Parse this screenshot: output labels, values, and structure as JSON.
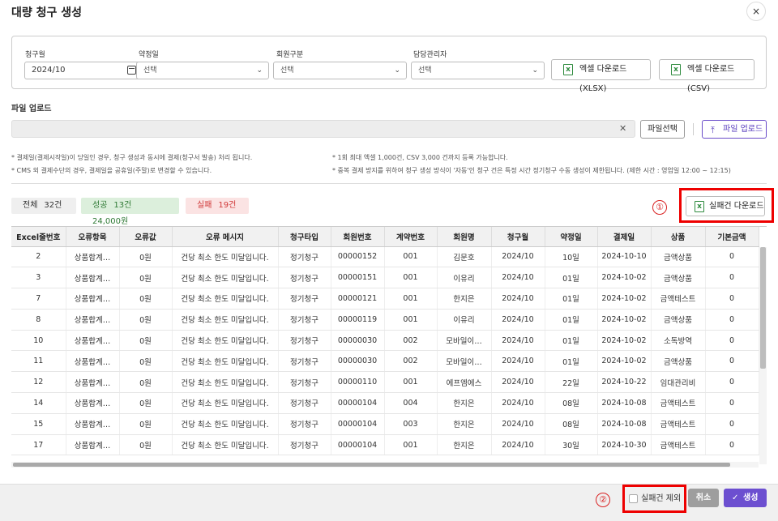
{
  "dialog": {
    "title": "대량 청구 생성",
    "close_icon": "×"
  },
  "filters": {
    "billing_month_label": "청구월",
    "billing_month_value": "2024/10",
    "contract_day_label": "약정일",
    "contract_day_value": "선택",
    "member_type_label": "회원구분",
    "member_type_value": "선택",
    "manager_label": "담당관리자",
    "manager_value": "선택",
    "excel_xlsx_label": "엑셀 다운로드(XLSX)",
    "excel_csv_label": "엑셀 다운로드(CSV)"
  },
  "upload": {
    "label": "파일 업로드",
    "select_label": "파일선택",
    "upload_label": "파일 업로드"
  },
  "notes": {
    "left_1": "* 결제일(결제시작일)이 당일인 경우, 청구 생성과 동시에 결제(청구서 발송) 처리 됩니다.",
    "left_2": "* CMS 외 결제수단의 경우, 결제일을 공휴일(주말)로 변경할 수 있습니다.",
    "right_1": "* 1회 최대 엑셀 1,000건, CSV 3,000 건까지 등록 가능합니다.",
    "right_2": "* 중복 결제 방지를 위하여 청구 생성 방식이 '자동'인 청구 건은 특정 시간 정기청구 수동 생성이 제한됩니다. (제한 시간 : 영업일 12:00 ~ 12:15)"
  },
  "summary": {
    "total_label": "전체",
    "total_count": "32건",
    "success_label": "성공",
    "success_count": "13건",
    "success_amount": "24,000원",
    "fail_label": "실패",
    "fail_count": "19건"
  },
  "annotations": {
    "one": "①",
    "two": "②"
  },
  "fail_download_label": "실패건 다운로드",
  "table": {
    "headers": [
      "Excel줄번호",
      "오류항목",
      "오류값",
      "오류 메시지",
      "청구타입",
      "회원번호",
      "계약번호",
      "회원명",
      "청구월",
      "약정일",
      "결제일",
      "상품",
      "기본금액"
    ],
    "rows": [
      [
        "2",
        "상품합계…",
        "0원",
        "건당 최소 한도 미달입니다.",
        "정기청구",
        "00000152",
        "001",
        "김문호",
        "2024/10",
        "10일",
        "2024-10-10",
        "금액상품",
        "0"
      ],
      [
        "3",
        "상품합계…",
        "0원",
        "건당 최소 한도 미달입니다.",
        "정기청구",
        "00000151",
        "001",
        "이유리",
        "2024/10",
        "01일",
        "2024-10-02",
        "금액상품",
        "0"
      ],
      [
        "7",
        "상품합계…",
        "0원",
        "건당 최소 한도 미달입니다.",
        "정기청구",
        "00000121",
        "001",
        "한지은",
        "2024/10",
        "01일",
        "2024-10-02",
        "금액테스트",
        "0"
      ],
      [
        "8",
        "상품합계…",
        "0원",
        "건당 최소 한도 미달입니다.",
        "정기청구",
        "00000119",
        "001",
        "이유리",
        "2024/10",
        "01일",
        "2024-10-02",
        "금액상품",
        "0"
      ],
      [
        "10",
        "상품합계…",
        "0원",
        "건당 최소 한도 미달입니다.",
        "정기청구",
        "00000030",
        "002",
        "모바일이…",
        "2024/10",
        "01일",
        "2024-10-02",
        "소독방역",
        "0"
      ],
      [
        "11",
        "상품합계…",
        "0원",
        "건당 최소 한도 미달입니다.",
        "정기청구",
        "00000030",
        "002",
        "모바일이…",
        "2024/10",
        "01일",
        "2024-10-02",
        "금액상품",
        "0"
      ],
      [
        "12",
        "상품합계…",
        "0원",
        "건당 최소 한도 미달입니다.",
        "정기청구",
        "00000110",
        "001",
        "에프엠에스",
        "2024/10",
        "22일",
        "2024-10-22",
        "임대관리비",
        "0"
      ],
      [
        "14",
        "상품합계…",
        "0원",
        "건당 최소 한도 미달입니다.",
        "정기청구",
        "00000104",
        "004",
        "한지은",
        "2024/10",
        "08일",
        "2024-10-08",
        "금액테스트",
        "0"
      ],
      [
        "15",
        "상품합계…",
        "0원",
        "건당 최소 한도 미달입니다.",
        "정기청구",
        "00000104",
        "003",
        "한지은",
        "2024/10",
        "08일",
        "2024-10-08",
        "금액테스트",
        "0"
      ],
      [
        "17",
        "상품합계…",
        "0원",
        "건당 최소 한도 미달입니다.",
        "정기청구",
        "00000104",
        "001",
        "한지은",
        "2024/10",
        "30일",
        "2024-10-30",
        "금액테스트",
        "0"
      ]
    ]
  },
  "footer": {
    "exclude_label": "실패건 제외",
    "cancel_label": "취소",
    "create_label": "생성"
  },
  "colors": {
    "accent": "#6c4fd0",
    "excel": "#2e8b3e",
    "annotation": "#e00000"
  }
}
